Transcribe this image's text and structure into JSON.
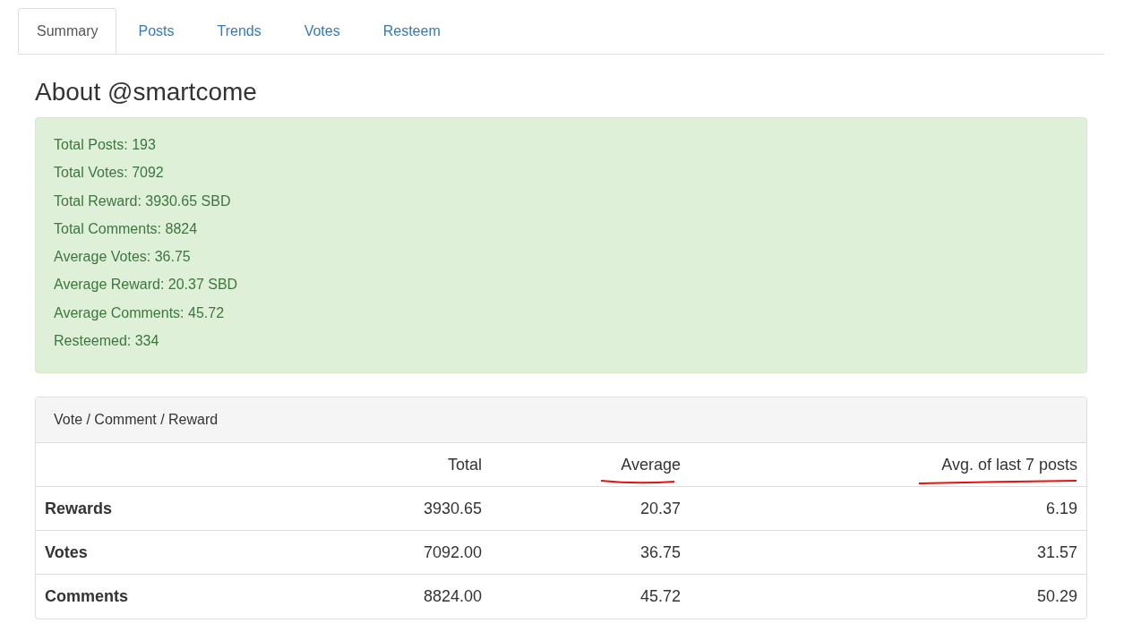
{
  "tabs": [
    {
      "label": "Summary",
      "selected": true
    },
    {
      "label": "Posts",
      "selected": false
    },
    {
      "label": "Trends",
      "selected": false
    },
    {
      "label": "Votes",
      "selected": false
    },
    {
      "label": "Resteem",
      "selected": false
    }
  ],
  "heading": "About @smartcome",
  "stats": [
    "Total Posts: 193",
    "Total Votes: 7092",
    "Total Reward: 3930.65 SBD",
    "Total Comments: 8824",
    "Average Votes: 36.75",
    "Average Reward: 20.37 SBD",
    "Average Comments: 45.72",
    "Resteemed: 334"
  ],
  "panel": {
    "title": "Vote / Comment / Reward",
    "columns": [
      {
        "label": "Total",
        "underlined": false
      },
      {
        "label": "Average",
        "underlined": true
      },
      {
        "label": "Avg. of last 7 posts",
        "underlined": true
      }
    ],
    "rows": [
      {
        "label": "Rewards",
        "values": [
          "3930.65",
          "20.37",
          "6.19"
        ]
      },
      {
        "label": "Votes",
        "values": [
          "7092.00",
          "36.75",
          "31.57"
        ]
      },
      {
        "label": "Comments",
        "values": [
          "8824.00",
          "45.72",
          "50.29"
        ]
      }
    ]
  }
}
